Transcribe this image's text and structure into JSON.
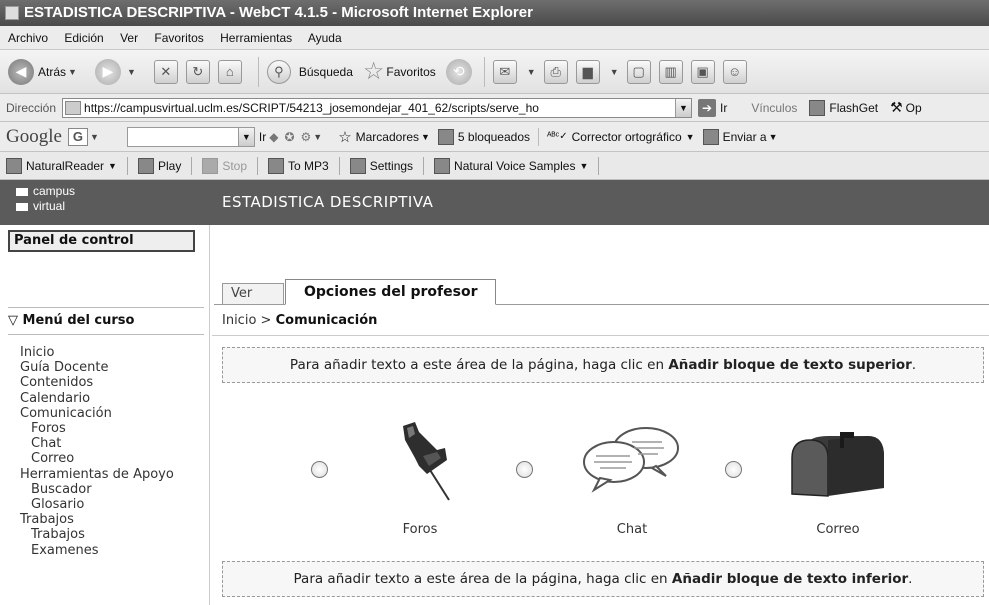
{
  "browser": {
    "title": "ESTADISTICA DESCRIPTIVA - WebCT 4.1.5 - Microsoft Internet Explorer",
    "menu": [
      "Archivo",
      "Edición",
      "Ver",
      "Favoritos",
      "Herramientas",
      "Ayuda"
    ],
    "toolbar": {
      "back": "Atrás",
      "search": "Búsqueda",
      "favorites": "Favoritos"
    },
    "address": {
      "label": "Dirección",
      "url": "https://campusvirtual.uclm.es/SCRIPT/54213_josemondejar_401_62/scripts/serve_ho",
      "go": "Ir",
      "links": "Vínculos",
      "flashget": "FlashGet",
      "more": "Op"
    },
    "google": {
      "logo": "Google",
      "g_button": "G",
      "go": "Ir",
      "bookmarks": "Marcadores",
      "blocked": "5 bloqueados",
      "spellcheck": "Corrector ortográfico",
      "send": "Enviar a"
    },
    "naturalreader": {
      "app": "NaturalReader",
      "play": "Play",
      "stop": "Stop",
      "to_mp3": "To MP3",
      "settings": "Settings",
      "samples": "Natural Voice Samples"
    }
  },
  "webct": {
    "logo_line1": "campus",
    "logo_line2": "virtual",
    "course_title": "ESTADISTICA DESCRIPTIVA",
    "control_panel": "Panel de control",
    "course_menu_title": "Menú del curso",
    "course_menu": [
      {
        "label": "Inicio",
        "indent": false
      },
      {
        "label": "Guía Docente",
        "indent": false
      },
      {
        "label": "Contenidos",
        "indent": false
      },
      {
        "label": "Calendario",
        "indent": false
      },
      {
        "label": "Comunicación",
        "indent": false
      },
      {
        "label": "Foros",
        "indent": true
      },
      {
        "label": "Chat",
        "indent": true
      },
      {
        "label": "Correo",
        "indent": true
      },
      {
        "label": "Herramientas de Apoyo",
        "indent": false
      },
      {
        "label": "Buscador",
        "indent": true
      },
      {
        "label": "Glosario",
        "indent": true
      },
      {
        "label": "Trabajos",
        "indent": false
      },
      {
        "label": "Trabajos",
        "indent": true
      },
      {
        "label": "Examenes",
        "indent": true
      }
    ],
    "tabs": {
      "view": "Ver",
      "teacher": "Opciones del profesor"
    },
    "breadcrumb": {
      "home": "Inicio",
      "sep": ">",
      "current": "Comunicación"
    },
    "top_block": {
      "prefix": "Para añadir texto a este área de la página, haga clic en ",
      "link": "Añadir bloque de texto superior",
      "suffix": "."
    },
    "bottom_block": {
      "prefix": "Para añadir texto a este área de la página, haga clic en ",
      "link": "Añadir bloque de texto inferior",
      "suffix": "."
    },
    "tools": [
      {
        "label": "Foros",
        "icon": "pushpin-icon"
      },
      {
        "label": "Chat",
        "icon": "speech-bubbles-icon",
        "bubble_text": "pey sdsfscr lisad rlxjlsl gsslls"
      },
      {
        "label": "Correo",
        "icon": "mailbox-icon"
      }
    ]
  }
}
